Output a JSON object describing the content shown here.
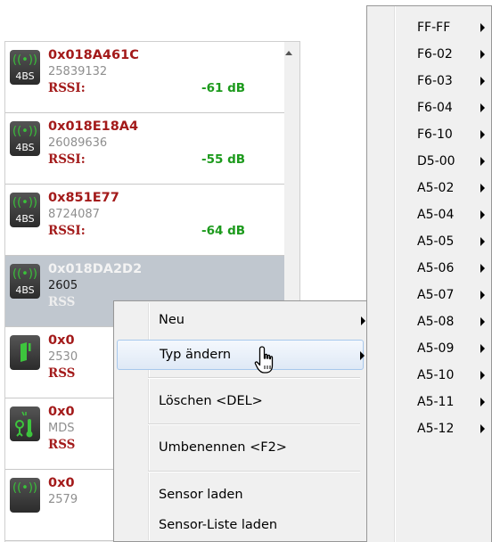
{
  "devices": [
    {
      "id": "0x018A461C",
      "number": "25839132",
      "rssi_label": "RSSI:",
      "rssi_value": "-61 dB",
      "type_badge": "4BS",
      "icon": "radio-signal-icon"
    },
    {
      "id": "0x018E18A4",
      "number": "26089636",
      "rssi_label": "RSSI:",
      "rssi_value": "-55 dB",
      "type_badge": "4BS",
      "icon": "radio-signal-icon"
    },
    {
      "id": "0x851E77",
      "number": "8724087",
      "rssi_label": "RSSI:",
      "rssi_value": "-64 dB",
      "type_badge": "4BS",
      "icon": "radio-signal-icon"
    },
    {
      "id": "0x018DA2D2",
      "number": "2605",
      "rssi_label": "RSS",
      "type_badge": "4BS",
      "icon": "radio-signal-icon",
      "selected": true
    },
    {
      "id": "0x0",
      "number": "2530",
      "rssi_label": "RSS",
      "icon": "door-contact-icon"
    },
    {
      "id": "0x0",
      "number": "MDS",
      "rssi_label": "RSS",
      "icon": "motion-temperature-icon"
    },
    {
      "id": "0x0",
      "number": "2579",
      "icon": "radio-signal-icon"
    }
  ],
  "context_menu": {
    "items": [
      {
        "label": "Neu",
        "has_submenu": true
      },
      {
        "label": "Typ ändern",
        "has_submenu": true,
        "highlighted": true
      },
      {
        "label": "Löschen <DEL>"
      },
      {
        "label": "Umbenennen <F2>"
      },
      {
        "label": "Sensor laden"
      },
      {
        "label": "Sensor-Liste laden"
      }
    ]
  },
  "type_menu": {
    "items": [
      "FF-FF",
      "F6-02",
      "F6-03",
      "F6-04",
      "F6-10",
      "D5-00",
      "A5-02",
      "A5-04",
      "A5-05",
      "A5-06",
      "A5-07",
      "A5-08",
      "A5-09",
      "A5-10",
      "A5-11",
      "A5-12"
    ]
  },
  "colors": {
    "device_id": "#a31a1a",
    "rssi_value": "#1c9a1c",
    "selected_row": "#c0c7cf",
    "menu_bg": "#f0f0f0",
    "menu_highlight": "#dfe9f6"
  }
}
